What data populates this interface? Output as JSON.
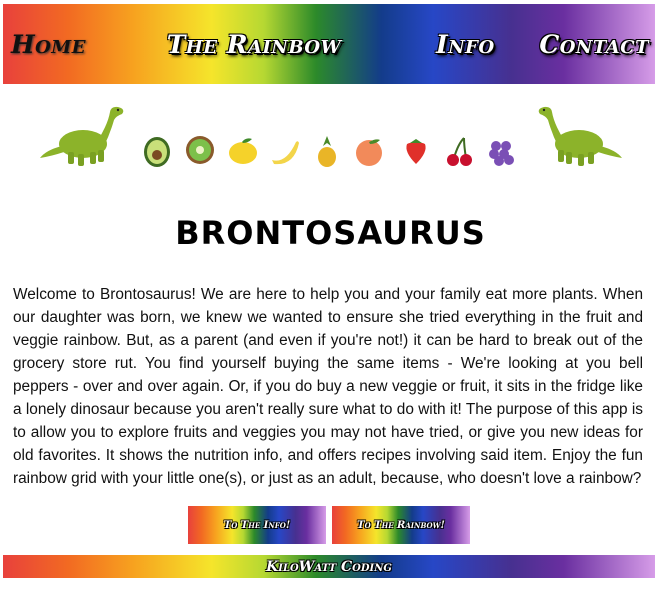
{
  "nav": {
    "home": "Home",
    "rainbow": "The Rainbow",
    "info": "Info",
    "contact": "Contact"
  },
  "hero": {
    "left_icon": "dinosaur-icon",
    "right_icon": "dinosaur-icon",
    "fruit_icons": [
      "avocado-icon",
      "kiwi-icon",
      "lemon-icon",
      "banana-icon",
      "pineapple-icon",
      "peach-icon",
      "strawberry-icon",
      "cherries-icon",
      "grapes-icon"
    ]
  },
  "main": {
    "title": "BRONTOSAURUS",
    "description": "Welcome to Brontosaurus! We are here to help you and your family eat more plants. When our daughter was born, we knew we wanted to ensure she tried everything in the fruit and veggie rainbow. But, as a parent (and even if you're not!) it can be hard to break out of the grocery store rut. You find yourself buying the same items - We're looking at you bell peppers - over and over again. Or, if you do buy a new veggie or fruit, it sits in the fridge like a lonely dinosaur because you aren't really sure what to do with it! The purpose of this app is to allow you to explore fruits and veggies you may not have tried, or give you new ideas for old favorites. It shows the nutrition info, and offers recipes involving said item. Enjoy the fun rainbow grid with your little one(s), or just as an adult, because, who doesn't love a rainbow?"
  },
  "buttons": {
    "info": "To The Info!",
    "rainbow": "To The Rainbow!"
  },
  "footer": {
    "text": "KiloWatt Coding"
  },
  "colors": {
    "gradient": [
      "#e8413c",
      "#f26a22",
      "#f7a21f",
      "#f5e52b",
      "#b6d832",
      "#2c8a2a",
      "#133c8a",
      "#2747c6",
      "#473090",
      "#6a2fa0",
      "#d69ce8"
    ],
    "dino_green": "#8cb32a"
  }
}
